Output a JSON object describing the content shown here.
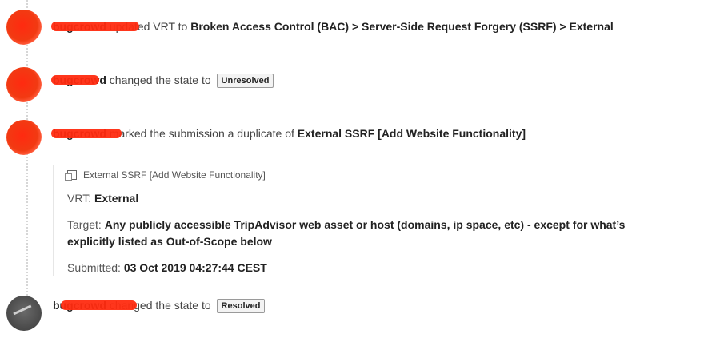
{
  "timeline": [
    {
      "user": "bugcrowd",
      "action": "updated VRT to",
      "target": "Broken Access Control (BAC) > Server-Side Request Forgery (SSRF) > External"
    },
    {
      "user": "bugcrowd",
      "action": "changed the state to",
      "badge": "Unresolved"
    },
    {
      "user": "bugcrowd",
      "action": "marked the submission a duplicate of",
      "target": "External SSRF [Add Website Functionality]",
      "details": {
        "link_label": "External SSRF [Add Website Functionality]",
        "vrt_label": "VRT:",
        "vrt_value": "External",
        "target_label": "Target:",
        "target_value": "Any publicly accessible TripAdvisor web asset or host (domains, ip space, etc) - except for what’s explicitly listed as Out-of-Scope below",
        "submitted_label": "Submitted:",
        "submitted_value": "03 Oct 2019 04:27:44 CEST"
      }
    },
    {
      "user": "bugcrowd",
      "action": "changed the state to",
      "badge": "Resolved"
    }
  ]
}
